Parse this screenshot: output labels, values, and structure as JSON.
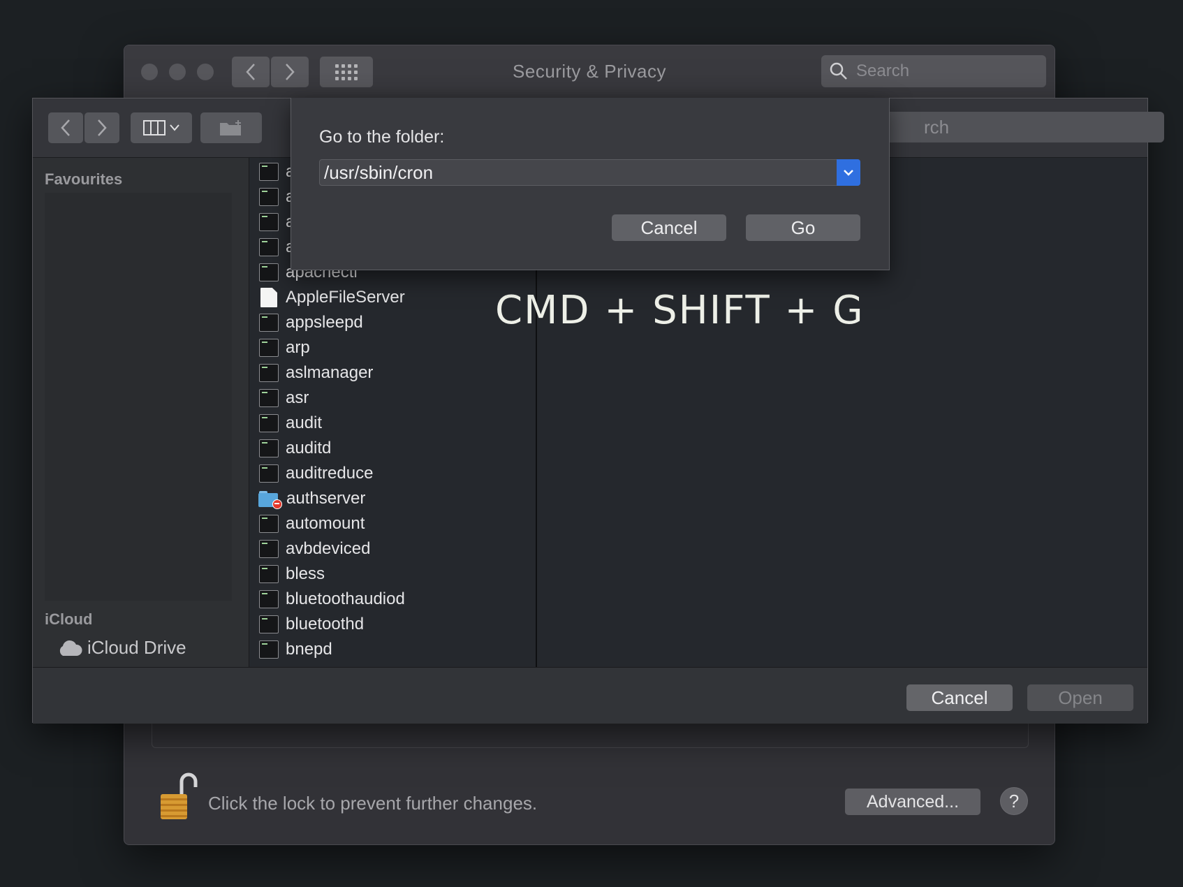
{
  "prefs": {
    "title": "Security & Privacy",
    "search_placeholder": "Search",
    "lock_text": "Click the lock to prevent further changes.",
    "advanced_label": "Advanced...",
    "help_label": "?"
  },
  "open_dialog": {
    "search_partial": "rch",
    "sidebar": {
      "favourites_heading": "Favourites",
      "icloud_heading": "iCloud",
      "icloud_drive_label": "iCloud Drive"
    },
    "files": [
      {
        "name": "a",
        "icon": "terminal-icon"
      },
      {
        "name": "a",
        "icon": "terminal-icon"
      },
      {
        "name": "a",
        "icon": "terminal-icon"
      },
      {
        "name": "a",
        "icon": "terminal-icon"
      },
      {
        "name": "apachectl",
        "icon": "terminal-icon"
      },
      {
        "name": "AppleFileServer",
        "icon": "document-icon"
      },
      {
        "name": "appsleepd",
        "icon": "terminal-icon"
      },
      {
        "name": "arp",
        "icon": "terminal-icon"
      },
      {
        "name": "aslmanager",
        "icon": "terminal-icon"
      },
      {
        "name": "asr",
        "icon": "terminal-icon"
      },
      {
        "name": "audit",
        "icon": "terminal-icon"
      },
      {
        "name": "auditd",
        "icon": "terminal-icon"
      },
      {
        "name": "auditreduce",
        "icon": "terminal-icon"
      },
      {
        "name": "authserver",
        "icon": "restricted-folder-icon"
      },
      {
        "name": "automount",
        "icon": "terminal-icon"
      },
      {
        "name": "avbdeviced",
        "icon": "terminal-icon"
      },
      {
        "name": "bless",
        "icon": "terminal-icon"
      },
      {
        "name": "bluetoothaudiod",
        "icon": "terminal-icon"
      },
      {
        "name": "bluetoothd",
        "icon": "terminal-icon"
      },
      {
        "name": "bnepd",
        "icon": "terminal-icon"
      }
    ],
    "cancel_label": "Cancel",
    "open_label": "Open"
  },
  "goto_sheet": {
    "label": "Go to the folder:",
    "path_value": "/usr/sbin/cron",
    "cancel_label": "Cancel",
    "go_label": "Go"
  },
  "overlay": {
    "caption": "CMD + SHIFT + G"
  },
  "colors": {
    "accent": "#2f6fe0",
    "background": "#1c2023"
  }
}
